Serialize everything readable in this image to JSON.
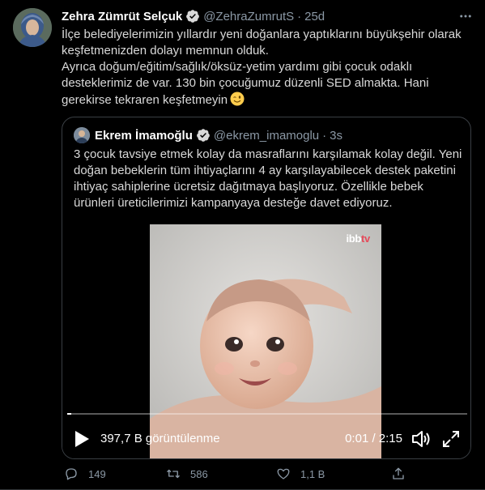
{
  "tweet": {
    "author_name": "Zehra Zümrüt Selçuk",
    "author_handle": "@ZehraZumrutS",
    "separator": "·",
    "time": "25d",
    "text_line1": "İlçe belediyelerimizin yıllardır yeni doğanlara yaptıklarını büyükşehir olarak keşfetmenizden dolayı memnun olduk.",
    "text_line2": "Ayrıca doğum/eğitim/sağlık/öksüz-yetim yardımı gibi çocuk odaklı desteklerimiz de var. 130 bin çocuğumuz düzenli SED almakta. Hani gerekirse tekraren keşfetmeyin",
    "emoji": "winking-face",
    "verified": true
  },
  "quoted": {
    "author_name": "Ekrem İmamoğlu",
    "author_handle": "@ekrem_imamoglu",
    "separator": "·",
    "time": "3s",
    "verified": true,
    "text": "3 çocuk tavsiye etmek kolay da masraflarını karşılamak kolay değil. Yeni doğan bebeklerin tüm ihtiyaçlarını 4 ay karşılayabilecek destek paketini ihtiyaç sahiplerine ücretsiz dağıtmaya başlıyoruz. Özellikle bebek ürünleri üreticilerimizi kampanyaya desteğe davet ediyoruz."
  },
  "video": {
    "logo_main": "ibb",
    "logo_accent": "tv",
    "views": "397,7 B görüntülenme",
    "duration": "0:01 / 2:15",
    "progress": 0.01
  },
  "actions": {
    "reply_count": "149",
    "retweet_count": "586",
    "like_count": "1,1 B"
  },
  "colors": {
    "background": "#000000",
    "verified": "#d9d9d9",
    "muted": "#8b98a5",
    "border": "#3a3f44"
  }
}
